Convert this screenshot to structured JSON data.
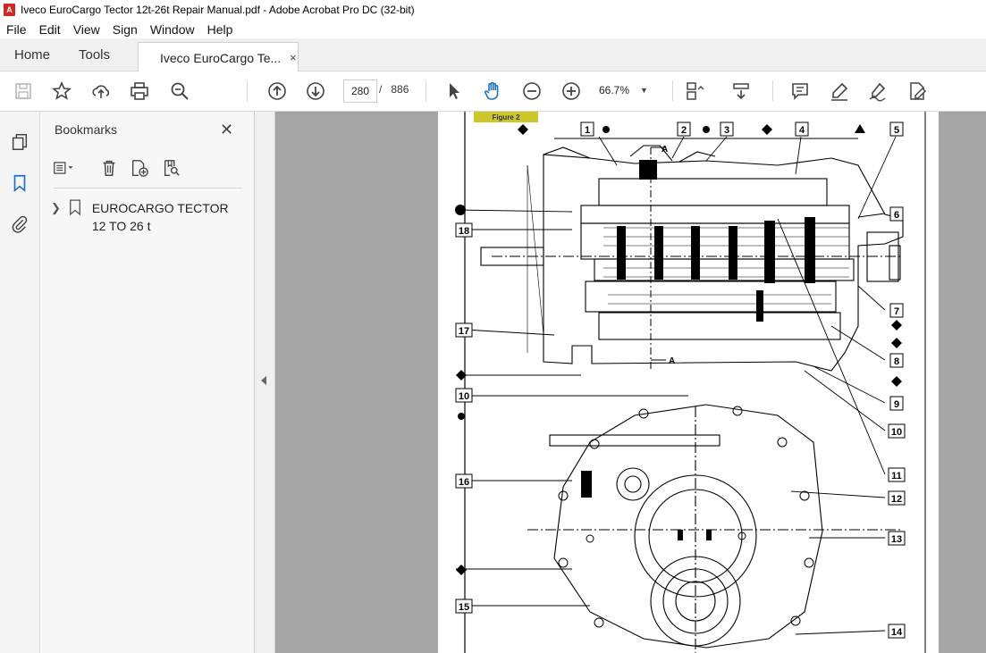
{
  "window": {
    "title": "Iveco EuroCargo Tector 12t-26t Repair Manual.pdf - Adobe Acrobat Pro DC (32-bit)",
    "app_icon_text": "A"
  },
  "menu": [
    "File",
    "Edit",
    "View",
    "Sign",
    "Window",
    "Help"
  ],
  "tabs": {
    "home": "Home",
    "tools": "Tools",
    "document": "Iveco EuroCargo Te...",
    "close": "×"
  },
  "toolbar": {
    "page_current": "280",
    "page_separator": "/",
    "page_total": "886",
    "zoom": "66.7%",
    "icons": [
      "save-icon",
      "star-icon",
      "upload-icon",
      "print-icon",
      "zoom-search-icon",
      "page-up-icon",
      "page-down-icon",
      "select-cursor-icon",
      "hand-tool-icon",
      "zoom-out-icon",
      "zoom-in-icon",
      "page-fit-icon",
      "scroll-mode-icon",
      "comment-icon",
      "highlight-icon",
      "sign-icon",
      "edit-pdf-icon"
    ]
  },
  "left_rail": [
    "pages-icon",
    "bookmark-icon",
    "attachment-icon"
  ],
  "bookmarks_panel": {
    "title": "Bookmarks",
    "close": "✕",
    "items": [
      {
        "label": "EUROCARGO TECTOR 12 TO 26 t"
      }
    ]
  },
  "document": {
    "figure_label": "Figure 2",
    "section_marker": "A",
    "callouts": [
      "1",
      "2",
      "3",
      "4",
      "5",
      "6",
      "7",
      "8",
      "9",
      "10",
      "10",
      "11",
      "12",
      "13",
      "14",
      "15",
      "16",
      "17",
      "18"
    ]
  },
  "colors": {
    "doc_bg": "#a5a5a5",
    "figure_label": "#ccc82a",
    "pdf_red": "#d7261e",
    "active_tool": "#1a73c9"
  }
}
